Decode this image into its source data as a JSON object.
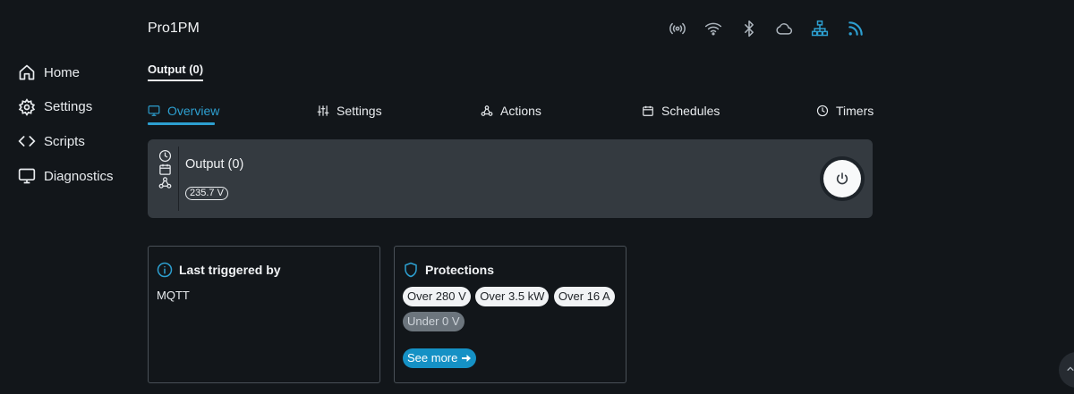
{
  "sidebar": {
    "items": [
      {
        "label": "Home",
        "icon": "home-icon"
      },
      {
        "label": "Settings",
        "icon": "gear-icon"
      },
      {
        "label": "Scripts",
        "icon": "code-icon"
      },
      {
        "label": "Diagnostics",
        "icon": "monitor-icon"
      }
    ]
  },
  "header": {
    "device_name": "Pro1PM",
    "status_icons": [
      "radio-broadcast-icon",
      "wifi-icon",
      "bluetooth-icon",
      "cloud-icon",
      "network-icon",
      "rss-icon"
    ],
    "active_icon_color": "#2d9fd0"
  },
  "output_tab": {
    "label": "Output (0)"
  },
  "tabs": [
    {
      "label": "Overview",
      "icon": "monitor-icon",
      "active": true
    },
    {
      "label": "Settings",
      "icon": "sliders-icon"
    },
    {
      "label": "Actions",
      "icon": "webhook-icon"
    },
    {
      "label": "Schedules",
      "icon": "calendar-icon"
    },
    {
      "label": "Timers",
      "icon": "clock-icon"
    }
  ],
  "output_card": {
    "title": "Output (0)",
    "voltage": "235.7 V",
    "side_icons": [
      "clock-icon",
      "calendar-icon",
      "webhook-icon"
    ],
    "power_icon": "power-icon"
  },
  "last_triggered": {
    "title": "Last triggered by",
    "value": "MQTT",
    "icon": "info-icon"
  },
  "protections": {
    "title": "Protections",
    "icon": "shield-icon",
    "items": [
      "Over 280 V",
      "Over 3.5 kW",
      "Over 16 A"
    ],
    "disabled_items": [
      "Under 0 V"
    ],
    "see_more_label": "See more"
  },
  "colors": {
    "accent": "#2d9fd0",
    "background": "#12161a",
    "card": "#343a40",
    "button": "#1591c5"
  }
}
